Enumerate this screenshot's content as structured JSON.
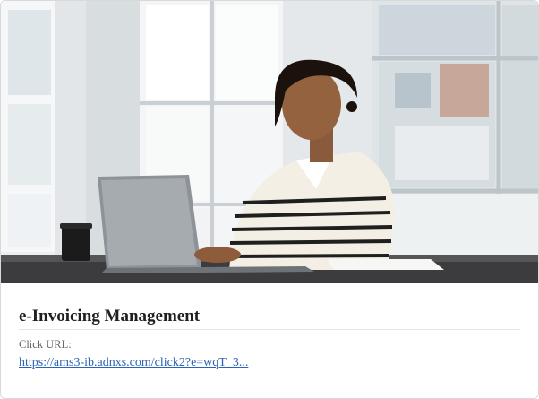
{
  "card": {
    "title": "e-Invoicing Management",
    "url_label": "Click URL:",
    "url_text": "https://ams3-ib.adnxs.com/click2?e=wqT_3..."
  },
  "colors": {
    "link": "#2a63b8",
    "title": "#1f1f1f",
    "label": "#666666"
  }
}
